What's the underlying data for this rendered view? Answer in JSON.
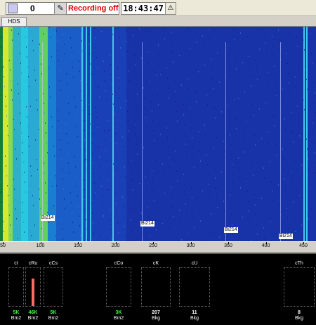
{
  "toolbar": {
    "counter_value": "0",
    "edit_icon": "pencil-icon",
    "recording_status": "Recording off",
    "clock": "18:43:47",
    "warning_icon": "radiation-warning-icon"
  },
  "tabs": [
    {
      "label": "HDS"
    }
  ],
  "spectrum": {
    "axis_ticks": [
      "50",
      "100",
      "150",
      "200",
      "250",
      "300",
      "350",
      "400",
      "450"
    ],
    "peaks": [
      {
        "label": "Bi214",
        "channel": 102
      },
      {
        "label": "Bi214",
        "channel": 235
      },
      {
        "label": "Bi214",
        "channel": 346
      },
      {
        "label": "Bi214",
        "channel": 419
      }
    ]
  },
  "bins": [
    {
      "name": "cI",
      "value": "5K",
      "unit": "Bm2",
      "value_color": "#3cff3c",
      "level": 0
    },
    {
      "name": "cRu",
      "value": "46K",
      "unit": "Bm2",
      "value_color": "#3cff3c",
      "level": 0.72
    },
    {
      "name": "cCs",
      "value": "5K",
      "unit": "Bm2",
      "value_color": "#3cff3c",
      "level": 0
    },
    {
      "name": "cCo",
      "value": "3K",
      "unit": "Bm2",
      "value_color": "#3cff3c",
      "level": 0
    },
    {
      "name": "cK",
      "value": "207",
      "unit": "Bkg",
      "value_color": "#ffffff",
      "level": 0
    },
    {
      "name": "cU",
      "value": "11",
      "unit": "Bkg",
      "value_color": "#ffffff",
      "level": 0
    },
    {
      "name": "cTh",
      "value": "8",
      "unit": "Bkg",
      "value_color": "#ffffff",
      "level": 0
    }
  ]
}
